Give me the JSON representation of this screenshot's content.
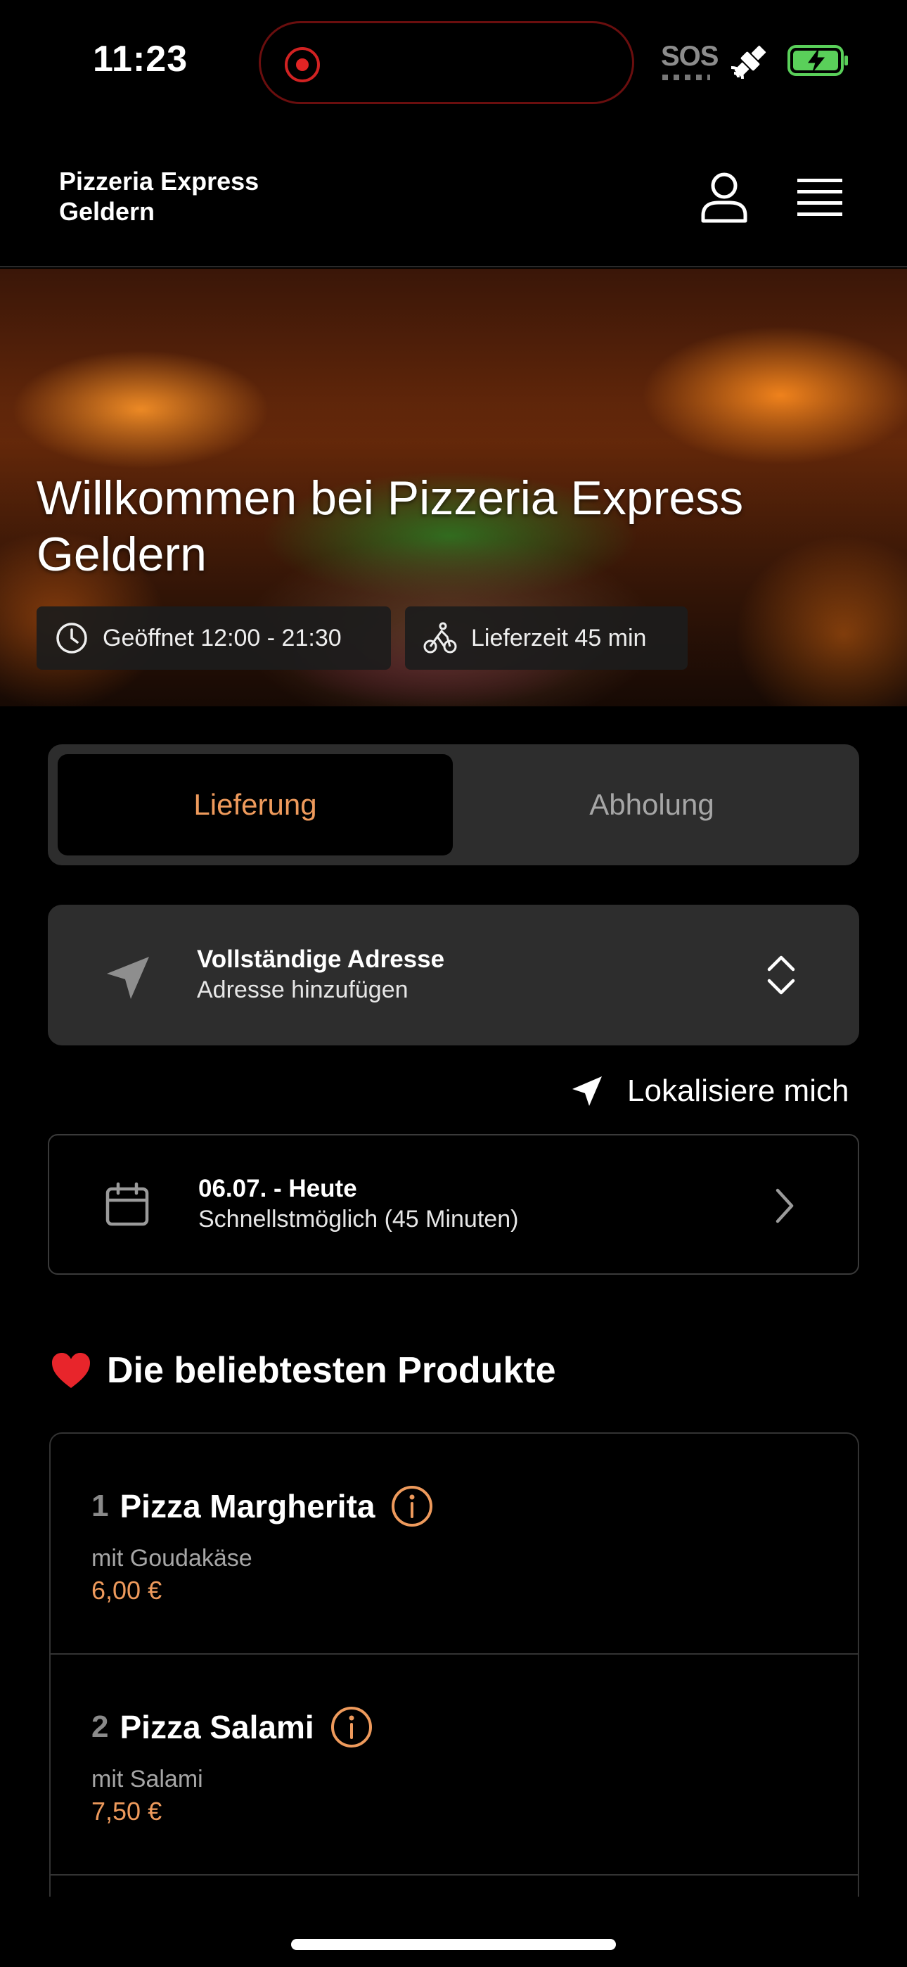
{
  "status_bar": {
    "time": "11:23",
    "sos": "SOS"
  },
  "header": {
    "brand_line1": "Pizzeria Express",
    "brand_line2": "Geldern"
  },
  "hero": {
    "title": "Willkommen bei Pizzeria Express Geldern",
    "opening_hours": "Geöffnet 12:00 - 21:30",
    "delivery_time": "Lieferzeit 45 min"
  },
  "mode": {
    "delivery_label": "Lieferung",
    "pickup_label": "Abholung",
    "active": "Lieferung"
  },
  "address": {
    "title": "Vollständige Adresse",
    "subtitle": "Adresse hinzufügen"
  },
  "locate_label": "Lokalisiere mich",
  "date": {
    "title": "06.07. - Heute",
    "subtitle": "Schnellstmöglich (45 Minuten)"
  },
  "popular": {
    "heading": "Die beliebtesten Produkte",
    "products": [
      {
        "number": "1",
        "name": "Pizza Margherita",
        "description": "mit Goudakäse",
        "price": "6,00 €"
      },
      {
        "number": "2",
        "name": "Pizza Salami",
        "description": "mit Salami",
        "price": "7,50 €"
      }
    ]
  },
  "colors": {
    "accent": "#ee9a5c",
    "background": "#000000",
    "card": "#2d2d2d"
  }
}
